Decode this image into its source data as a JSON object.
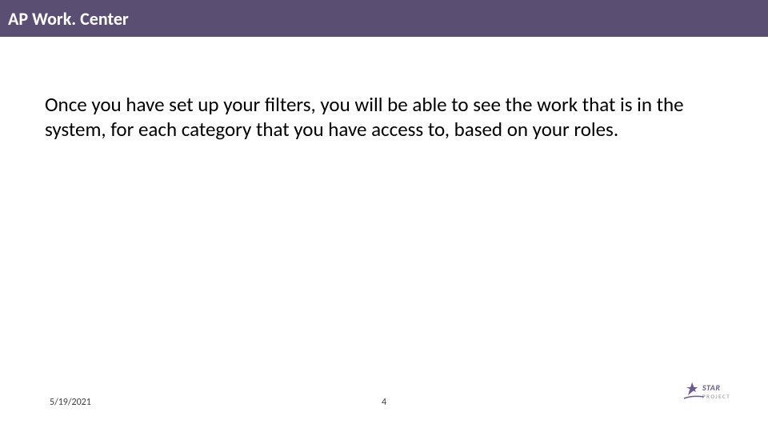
{
  "header": {
    "title": "AP Work. Center"
  },
  "body": {
    "paragraph": "Once you have set up your filters, you will be able to see the work that is in the system, for each category that you have access to, based on your roles."
  },
  "footer": {
    "date": "5/19/2021",
    "page_number": "4",
    "logo": {
      "name": "star-project-logo",
      "text_top": "STAR",
      "text_bottom": "PROJECT"
    }
  }
}
